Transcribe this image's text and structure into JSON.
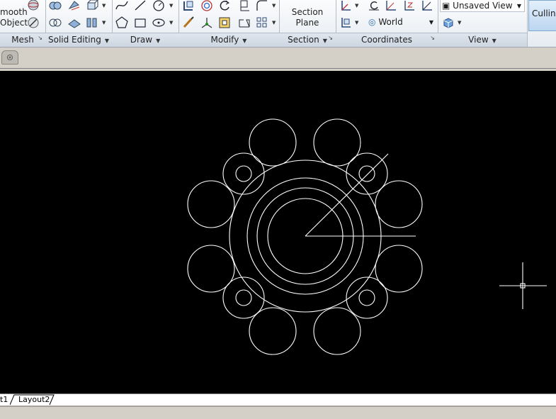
{
  "ribbon": {
    "panels": {
      "mesh": "Mesh",
      "solid_editing": "Solid Editing",
      "draw": "Draw",
      "modify": "Modify",
      "section": "Section",
      "coordinates": "Coordinates",
      "view": "View"
    },
    "smooth_object_line1": "mooth",
    "smooth_object_line2": "Object",
    "section_plane_line1": "Section",
    "section_plane_line2": "Plane",
    "named_view": "Unsaved View",
    "ucs": "World",
    "culling": "Culling"
  },
  "layout_tabs": [
    "t1",
    "Layout2"
  ],
  "colors": {
    "canvas_background": "#000000",
    "drawing_lines": "#ffffff",
    "ribbon_highlight": "#bcd6f1"
  }
}
